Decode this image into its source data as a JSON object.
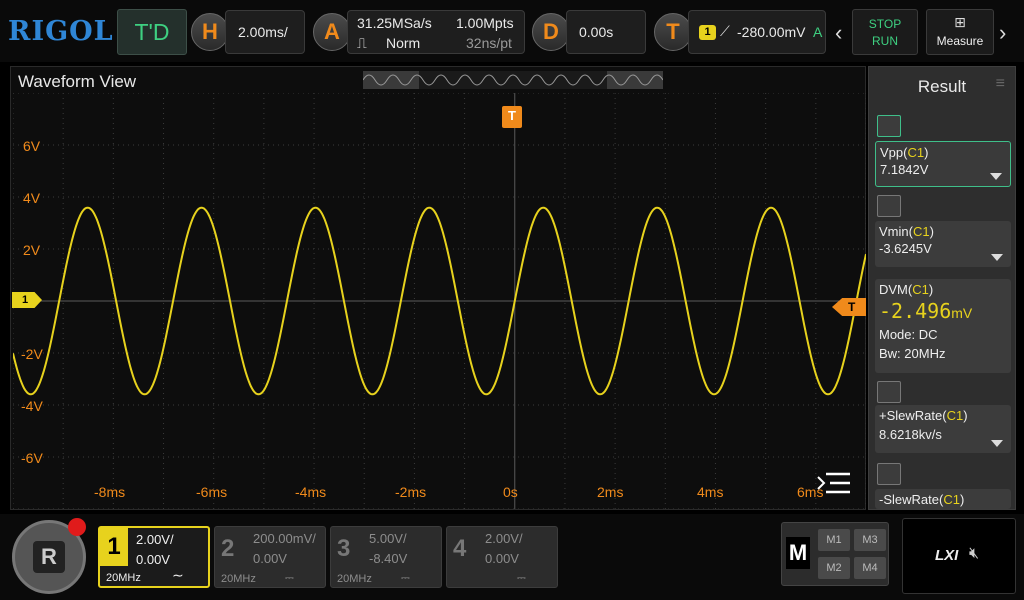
{
  "brand": "RIGOL",
  "top": {
    "td_label": "T'D",
    "horizontal": {
      "icon": "H",
      "value": "2.00ms/"
    },
    "acquire": {
      "icon": "A",
      "sample_rate": "31.25MSa/s",
      "mode": "Norm",
      "memory_depth": "1.00Mpts",
      "resolution": "32ns/pt"
    },
    "delay": {
      "icon": "D",
      "value": "0.00s"
    },
    "trigger": {
      "icon": "T",
      "source": "1",
      "level": "-280.00mV",
      "mode": "A"
    },
    "run_state": {
      "stop": "STOP",
      "run": "RUN"
    },
    "measure_label": "Measure"
  },
  "waveform": {
    "title": "Waveform View",
    "trigger_marker": "T",
    "channel_marker": "1",
    "y_labels": [
      "6V",
      "4V",
      "2V",
      "-2V",
      "-4V",
      "-6V"
    ],
    "x_labels": [
      "-8ms",
      "-6ms",
      "-4ms",
      "-2ms",
      "0s",
      "2ms",
      "4ms",
      "6ms"
    ]
  },
  "result": {
    "title": "Result",
    "items": [
      {
        "name": "Vpp",
        "ch": "C1",
        "value": "7.1842V"
      },
      {
        "name": "Vmin",
        "ch": "C1",
        "value": "-3.6245V"
      },
      {
        "name": "DVM",
        "ch": "C1",
        "value": "-2.496",
        "unit": "mV",
        "mode": "Mode: DC",
        "bw": "Bw:   20MHz"
      },
      {
        "name": "+SlewRate",
        "ch": "C1",
        "value": "8.6218kv/s"
      },
      {
        "name": "-SlewRate",
        "ch": "C1"
      }
    ]
  },
  "channels": [
    {
      "num": "1",
      "scale": "2.00V/",
      "offset": "0.00V",
      "bw": "20MHz"
    },
    {
      "num": "2",
      "scale": "200.00mV/",
      "offset": "0.00V",
      "bw": "20MHz"
    },
    {
      "num": "3",
      "scale": "5.00V/",
      "offset": "-8.40V",
      "bw": "20MHz"
    },
    {
      "num": "4",
      "scale": "2.00V/",
      "offset": "0.00V",
      "bw": ""
    }
  ],
  "math": {
    "label": "M",
    "buttons": [
      "M1",
      "M3",
      "M2",
      "M4"
    ]
  },
  "lxi_label": "LXI",
  "colors": {
    "ch1": "#e7d21d",
    "accent": "#f08a1b",
    "td": "#3ed081",
    "brand": "#2f86d6"
  },
  "chart_data": {
    "type": "line",
    "x_unit": "ms",
    "y_unit": "V",
    "xlim": [
      -10,
      7
    ],
    "ylim": [
      -8,
      8
    ],
    "series": [
      {
        "name": "C1",
        "function": "sine",
        "amplitude_v": 3.59,
        "period_ms": 2.27,
        "phase_at_0": "rising-crossing"
      }
    ]
  }
}
